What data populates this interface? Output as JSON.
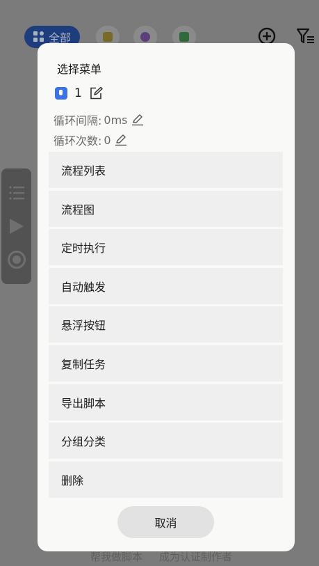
{
  "background": {
    "chip_all_label": "全部",
    "bottom_links": [
      "帮我做脚本",
      "成为认证制作者"
    ]
  },
  "dialog": {
    "title": "选择菜单",
    "task_name": "1",
    "interval_label": "循环间隔:",
    "interval_value": "0ms",
    "count_label": "循环次数:",
    "count_value": "0",
    "menu_items": [
      {
        "label": "流程列表"
      },
      {
        "label": "流程图"
      },
      {
        "label": "定时执行"
      },
      {
        "label": "自动触发"
      },
      {
        "label": "悬浮按钮"
      },
      {
        "label": "复制任务"
      },
      {
        "label": "导出脚本"
      },
      {
        "label": "分组分类"
      },
      {
        "label": "删除"
      }
    ],
    "cancel_label": "取消"
  },
  "colors": {
    "overlay": "#7b7b7b",
    "dialog_bg": "#f9f9f7",
    "menu_item_bg": "#efefef",
    "cancel_bg": "#e2e2e2",
    "accent": "#3b73e6"
  }
}
